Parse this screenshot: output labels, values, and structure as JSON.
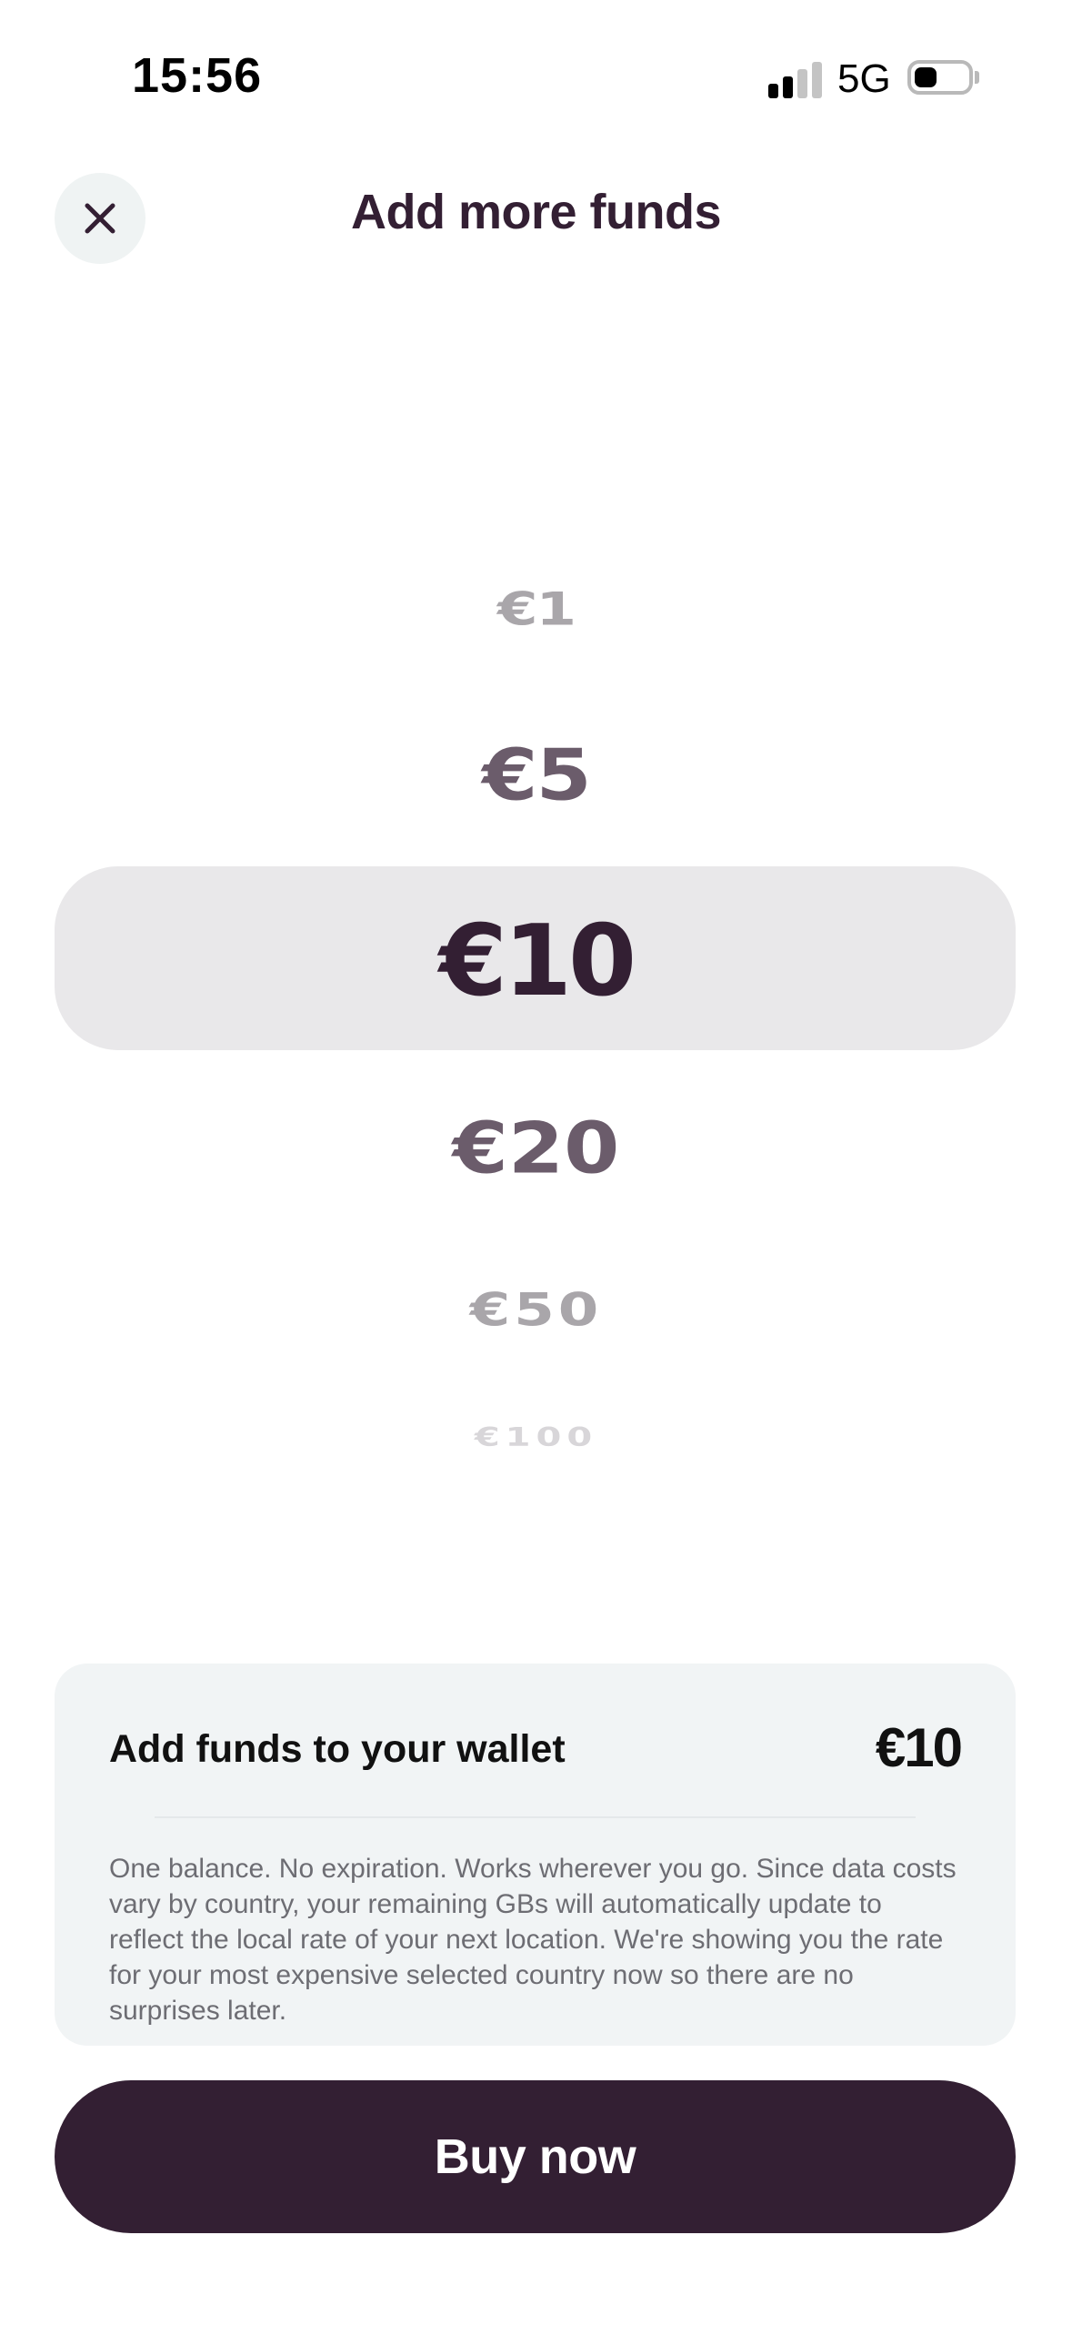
{
  "status_bar": {
    "time": "15:56",
    "network": "5G",
    "signal_bars_active": 2,
    "signal_bars_total": 4,
    "battery_level": 0.3
  },
  "header": {
    "title": "Add more funds",
    "close_icon": "close-icon"
  },
  "picker": {
    "options": [
      "€1",
      "€5",
      "€10",
      "€20",
      "€50",
      "€100"
    ],
    "selected": "€10"
  },
  "summary": {
    "label": "Add funds to your wallet",
    "amount": "€10",
    "description": "One balance. No expiration. Works wherever you go. Since data costs vary by country, your remaining GBs will automatically update to reflect the local rate of your next location. We're showing you the rate for your most expensive selected country now so there are no surprises later."
  },
  "buy_button": {
    "label": "Buy now"
  },
  "colors": {
    "brand": "#331f33",
    "card_bg": "#f1f4f5",
    "highlight_bg": "#e9e8ea"
  }
}
